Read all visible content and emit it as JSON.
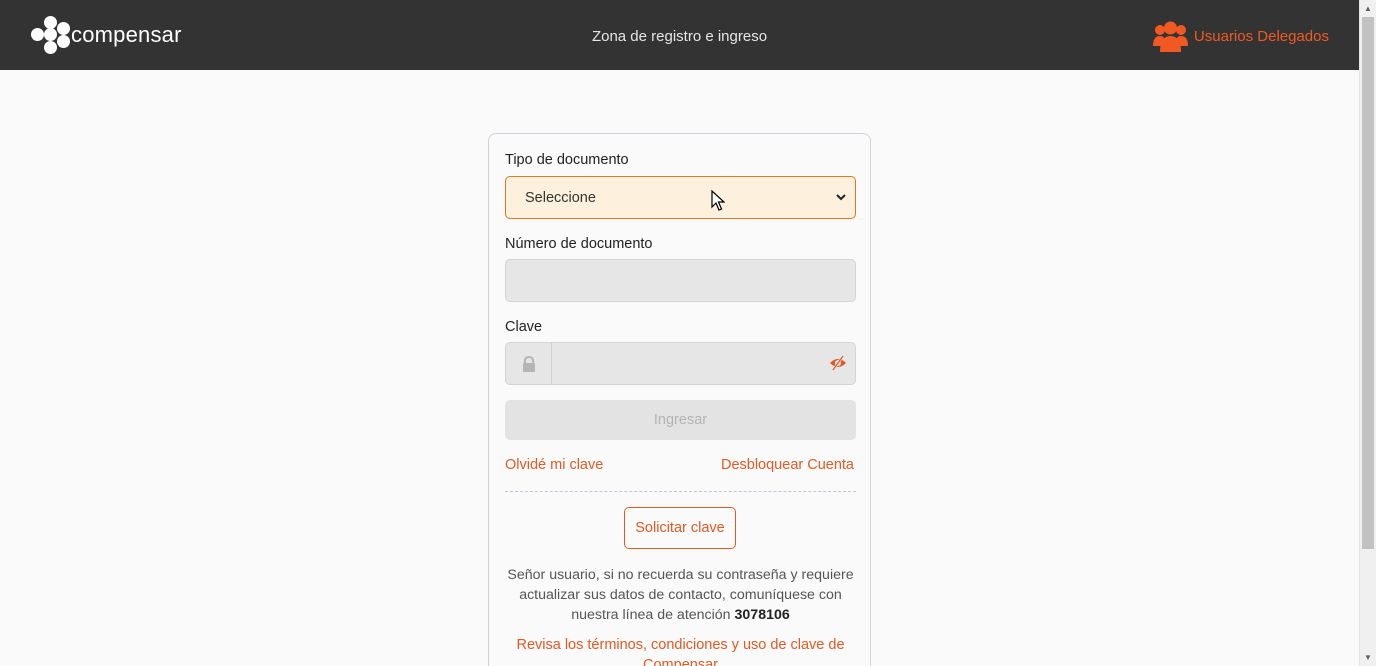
{
  "header": {
    "brand": "compensar",
    "title": "Zona de registro e ingreso",
    "delegated_users": "Usuarios Delegados",
    "delegated_icon": "users-group-icon"
  },
  "form": {
    "doc_type_label": "Tipo de documento",
    "doc_type_value": "Seleccione",
    "doc_number_label": "Número de documento",
    "doc_number_value": "",
    "password_label": "Clave",
    "password_value": "",
    "submit_label": "Ingresar",
    "forgot_label": "Olvidé mi clave",
    "unlock_label": "Desbloquear Cuenta",
    "request_label": "Solicitar clave",
    "info_text": "Señor usuario, si no recuerda su contraseña y requiere actualizar sus datos de contacto, comuníquese con nuestra línea de atención",
    "info_phone": "3078106",
    "terms_text": "Revisa los términos, condiciones y uso de clave de Compensar"
  },
  "colors": {
    "brand_orange": "#f05a22",
    "header_bg": "#333333",
    "select_bg": "#fdf0dd"
  }
}
